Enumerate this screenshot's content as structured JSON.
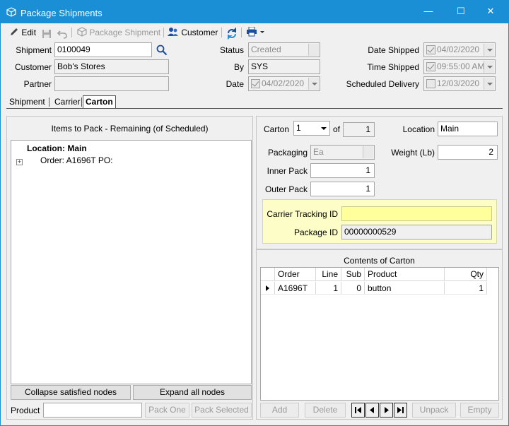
{
  "window": {
    "title": "Package Shipments",
    "minimize_glyph": "—",
    "maximize_glyph": "☐",
    "close_glyph": "✕"
  },
  "toolbar": {
    "edit_label": "Edit",
    "package_shipment_label": "Package Shipment",
    "customer_label": "Customer"
  },
  "header": {
    "shipment_label": "Shipment",
    "shipment_value": "0100049",
    "customer_label": "Customer",
    "customer_value": "Bob's Stores",
    "partner_label": "Partner",
    "partner_value": "",
    "status_label": "Status",
    "status_value": "Created",
    "by_label": "By",
    "by_value": "SYS",
    "date_label": "Date",
    "date_value": "04/02/2020",
    "date_shipped_label": "Date Shipped",
    "date_shipped_value": "04/02/2020",
    "time_shipped_label": "Time Shipped",
    "time_shipped_value": "09:55:00 AM",
    "scheduled_delivery_label": "Scheduled Delivery",
    "scheduled_delivery_value": "12/03/2020"
  },
  "tabs": [
    {
      "label": "Shipment"
    },
    {
      "label": "Carrier"
    },
    {
      "label": "Carton"
    }
  ],
  "items_panel": {
    "title": "Items to Pack  -  Remaining (of Scheduled)",
    "location_node": "Location: Main",
    "order_node": "Order: A1696T PO:",
    "expand_glyph": "+",
    "collapse_button": "Collapse satisfied nodes",
    "expand_button": "Expand all nodes",
    "product_label": "Product",
    "product_value": "",
    "pack_one_button": "Pack One",
    "pack_selected_button": "Pack Selected"
  },
  "carton": {
    "carton_label": "Carton",
    "carton_value": "1",
    "of_label": "of",
    "of_value": "1",
    "location_label": "Location",
    "location_value": "Main",
    "packaging_label": "Packaging",
    "packaging_value": "Ea",
    "weight_label": "Weight (Lb)",
    "weight_value": "2",
    "inner_pack_label": "Inner Pack",
    "inner_pack_value": "1",
    "outer_pack_label": "Outer Pack",
    "outer_pack_value": "1",
    "tracking_label": "Carrier Tracking ID",
    "tracking_value": "",
    "package_id_label": "Package ID",
    "package_id_value": "00000000529",
    "highlight_color": "#ffff9c"
  },
  "contents": {
    "title": "Contents of Carton",
    "columns": [
      "Order",
      "Line",
      "Sub",
      "Product",
      "Qty"
    ],
    "rows": [
      {
        "order": "A1696T",
        "line": "1",
        "sub": "0",
        "product": "button",
        "qty": "1"
      }
    ],
    "add_button": "Add",
    "delete_button": "Delete",
    "unpack_button": "Unpack",
    "empty_button": "Empty"
  }
}
